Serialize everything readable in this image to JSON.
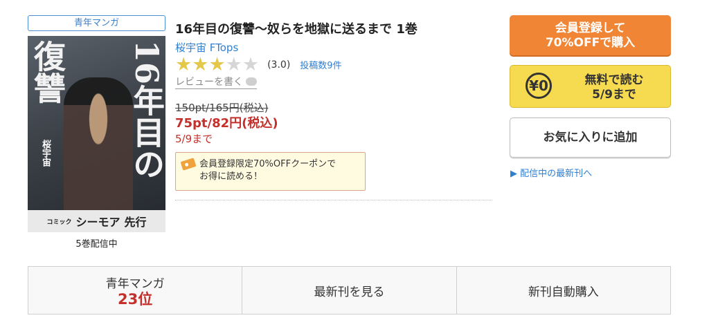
{
  "genre_tag": "青年マンガ",
  "cover": {
    "title_right": "16年目の",
    "title_left": "復讐",
    "author": "桜宇宙",
    "label_small": "コミック",
    "label_brand": "シーモア",
    "label_tag": "先行"
  },
  "volumes_text": "5巻配信中",
  "book": {
    "title": "16年目の復讐〜奴らを地獄に送るまで 1巻",
    "authors": "桜宇宙 FTops",
    "rating_value": 3.0,
    "rating_text": "(3.0)",
    "review_count": "投稿数9件",
    "write_review": "レビューを書く",
    "old_price": "150pt/165円(税込)",
    "new_price": "75pt/82円(税込)",
    "until": "5/9まで",
    "coupon_line1": "会員登録限定70%OFFクーポンで",
    "coupon_line2": "お得に読める！"
  },
  "buttons": {
    "member_line1": "会員登録して",
    "member_line2": "70%OFFで購入",
    "free_badge": "¥0",
    "free_line1": "無料で読む",
    "free_line2": "5/9まで",
    "favorite": "お気に入りに追加"
  },
  "latest_link": "▶ 配信中の最新刊へ",
  "bottom": {
    "genre": "青年マンガ",
    "rank": "23位",
    "see_latest": "最新刊を見る",
    "auto_buy": "新刊自動購入"
  },
  "colors": {
    "accent_blue": "#2f7fd1",
    "price_red": "#c4302b",
    "orange_button": "#f08535",
    "yellow_button": "#f6da4f",
    "star_on": "#e3c84a"
  }
}
